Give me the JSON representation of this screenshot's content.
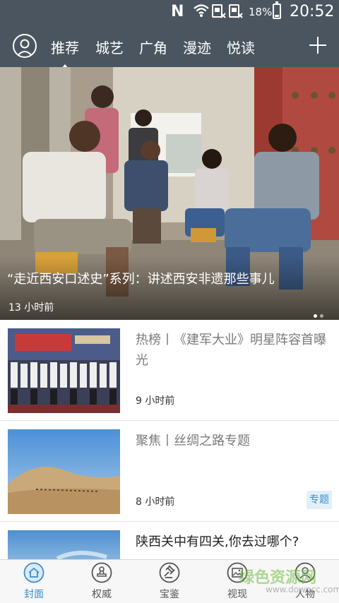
{
  "status_bar": {
    "carrier_icon": "N",
    "battery_percent": "18%",
    "time": "20:52"
  },
  "nav": {
    "tabs": [
      {
        "label": "推荐",
        "active": true
      },
      {
        "label": "城艺",
        "active": false
      },
      {
        "label": "广角",
        "active": false
      },
      {
        "label": "漫迹",
        "active": false
      },
      {
        "label": "悦读",
        "active": false
      }
    ],
    "icons": [
      "user-avatar-icon",
      "plus-icon"
    ]
  },
  "hero": {
    "headline": "“走近西安口述史”系列：讲述西安非遗那些事儿",
    "time": "13 小时前",
    "page_count": 2,
    "active_page": 1
  },
  "news": [
    {
      "title": "热榜丨《建军大业》明星阵容首曝光",
      "time": "9 小时前",
      "tag": "",
      "read": true
    },
    {
      "title": "聚焦丨丝绸之路专题",
      "time": "8 小时前",
      "tag": "专题",
      "read": true
    },
    {
      "title": "陕西关中有四关,你去过哪个?",
      "time": "",
      "tag": "",
      "read": false
    }
  ],
  "bottom_nav": {
    "items": [
      {
        "label": "封面",
        "icon": "home-icon",
        "active": true
      },
      {
        "label": "权威",
        "icon": "stamp-icon",
        "active": false
      },
      {
        "label": "宝鉴",
        "icon": "gavel-icon",
        "active": false
      },
      {
        "label": "视现",
        "icon": "image-icon",
        "active": false
      },
      {
        "label": "人物",
        "icon": "person-icon",
        "active": false
      }
    ]
  },
  "watermark": {
    "text": "绿色资源网",
    "url": "www.downcc.com"
  },
  "colors": {
    "header_bg": "#4a5560",
    "accent": "#3a8fd0",
    "tag_text": "#3d8cc6",
    "tag_bg": "#e2f0f9"
  }
}
